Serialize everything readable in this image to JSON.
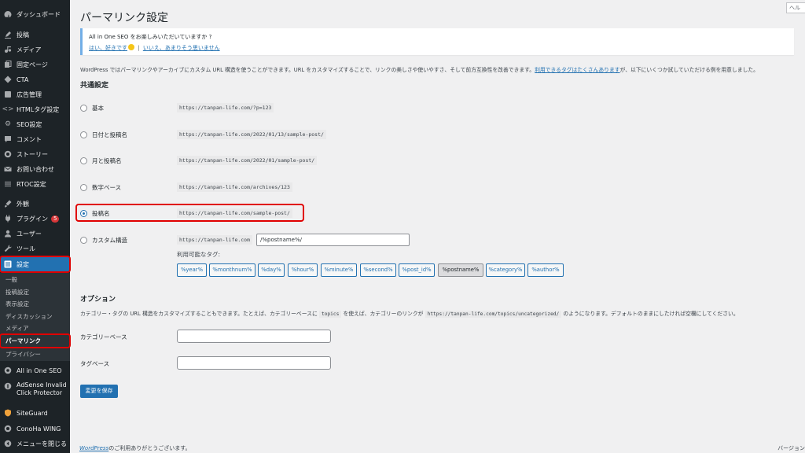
{
  "sidebar": {
    "items": [
      {
        "label": "ダッシュボード",
        "icon": "dashboard-icon"
      },
      {
        "label": "投稿",
        "icon": "posts-icon"
      },
      {
        "label": "メディア",
        "icon": "media-icon"
      },
      {
        "label": "固定ページ",
        "icon": "pages-icon"
      },
      {
        "label": "CTA",
        "icon": "cta-icon"
      },
      {
        "label": "広告管理",
        "icon": "ads-icon"
      },
      {
        "label": "HTMLタグ設定",
        "icon": "code-icon"
      },
      {
        "label": "SEO設定",
        "icon": "gear-icon"
      },
      {
        "label": "コメント",
        "icon": "comments-icon"
      },
      {
        "label": "ストーリー",
        "icon": "story-icon"
      },
      {
        "label": "お問い合わせ",
        "icon": "mail-icon"
      },
      {
        "label": "RTOC設定",
        "icon": "list-icon"
      },
      {
        "label": "外観",
        "icon": "appearance-icon"
      },
      {
        "label": "プラグイン",
        "icon": "plugins-icon",
        "badge": "5"
      },
      {
        "label": "ユーザー",
        "icon": "users-icon"
      },
      {
        "label": "ツール",
        "icon": "tools-icon"
      },
      {
        "label": "設定",
        "icon": "settings-icon",
        "active": true
      }
    ],
    "submenu": [
      "一般",
      "投稿設定",
      "表示設定",
      "ディスカッション",
      "メディア",
      "パーマリンク",
      "プライバシー"
    ],
    "lower_items": [
      {
        "label": "All in One SEO",
        "icon": "aioseo-icon"
      },
      {
        "label": "AdSense Invalid Click Protector",
        "line1": "AdSense Invalid",
        "line2": "Click Protector",
        "icon": "adsense-icon"
      },
      {
        "label": "SiteGuard",
        "icon": "siteguard-icon"
      },
      {
        "label": "ConoHa WING",
        "icon": "conoha-icon"
      },
      {
        "label": "メニューを閉じる",
        "icon": "collapse-icon"
      }
    ]
  },
  "header": {
    "title": "パーマリンク設定",
    "help_tab": "ヘルプ"
  },
  "notice": {
    "question": "All in One SEO をお楽しみいただいていますか ?",
    "yes_link": "はい、好きです",
    "separator": "|",
    "no_link": "いいえ、あまりそう思いません"
  },
  "intro": {
    "text_before": "WordPress ではパーマリンクやアーカイブにカスタム URL 構造を使うことができます。URL をカスタマイズすることで、リンクの美しさや使いやすさ、そして前方互換性を改善できます。",
    "link": "利用できるタグはたくさんあります",
    "text_after": "が、以下にいくつか試していただける例を用意しました。"
  },
  "common_settings": {
    "heading": "共通設定",
    "options": [
      {
        "label": "基本",
        "example": "https://tanpan-life.com/?p=123",
        "checked": false
      },
      {
        "label": "日付と投稿名",
        "example": "https://tanpan-life.com/2022/01/13/sample-post/",
        "checked": false
      },
      {
        "label": "月と投稿名",
        "example": "https://tanpan-life.com/2022/01/sample-post/",
        "checked": false
      },
      {
        "label": "数字ベース",
        "example": "https://tanpan-life.com/archives/123",
        "checked": false
      },
      {
        "label": "投稿名",
        "example": "https://tanpan-life.com/sample-post/",
        "checked": true
      },
      {
        "label": "カスタム構造",
        "example": "https://tanpan-life.com",
        "checked": false
      }
    ],
    "custom_value": "/%postname%/",
    "available_tags_label": "利用可能なタグ:",
    "tags": [
      "%year%",
      "%monthnum%",
      "%day%",
      "%hour%",
      "%minute%",
      "%second%",
      "%post_id%",
      "%postname%",
      "%category%",
      "%author%"
    ],
    "pressed_tag": "%postname%"
  },
  "options_section": {
    "heading": "オプション",
    "desc_before": "カテゴリー・タグの URL 構造をカスタマイズすることもできます。たとえば、カテゴリーベースに",
    "desc_code1": "topics",
    "desc_middle": "を使えば、カテゴリーのリンクが",
    "desc_code2": "https://tanpan-life.com/topics/uncategorized/",
    "desc_after": "のようになります。デフォルトのままにしたければ空欄にしてください。",
    "category_base_label": "カテゴリーベース",
    "category_base_value": "",
    "tag_base_label": "タグベース",
    "tag_base_value": ""
  },
  "save_button": "変更を保存",
  "footer": {
    "link": "WordPress",
    "text": "のご利用ありがとうございます。",
    "version": "バージョン"
  },
  "colors": {
    "sidebar_bg": "#1d2327",
    "accent": "#2271b1",
    "highlight_outline": "#e00000"
  }
}
